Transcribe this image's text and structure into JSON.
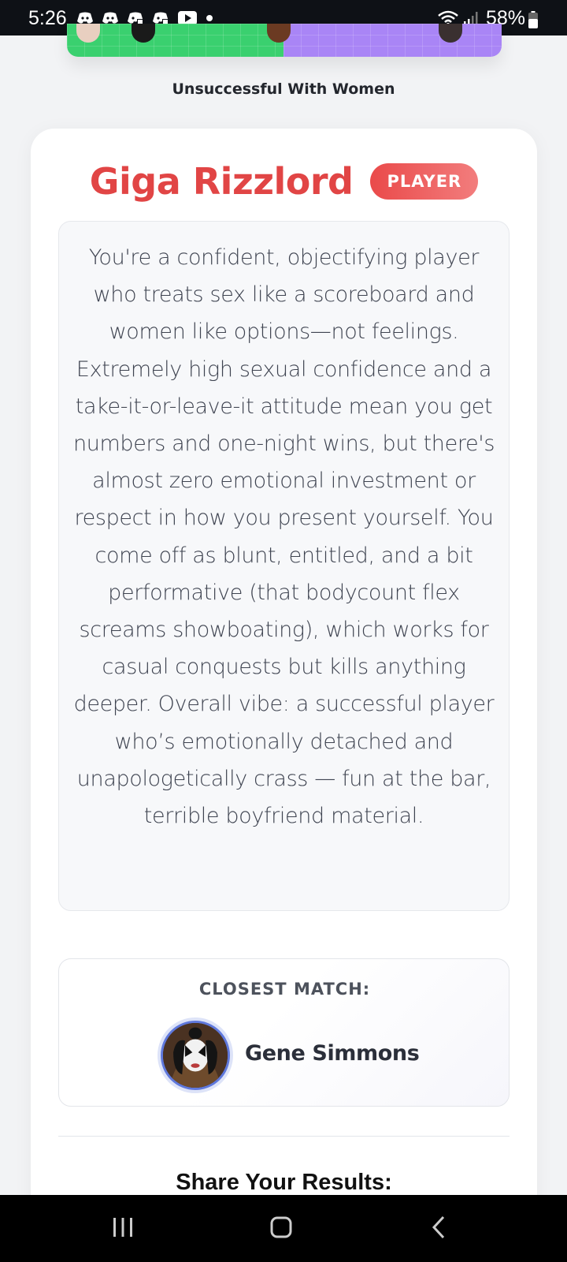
{
  "status_bar": {
    "time": "5:26",
    "battery": "58%",
    "notification_icons": [
      "discord-icon",
      "discord-icon",
      "discord-alt-icon",
      "discord-alt-icon",
      "youtube-icon"
    ]
  },
  "banner": {
    "caption": "Unsuccessful With Women"
  },
  "result": {
    "title": "Giga Rizzlord",
    "badge": "PLAYER",
    "description": "You're a confident, objectifying player who treats sex like a scoreboard and women like options—not feelings. Extremely high sexual confidence and a take-it-or-leave-it attitude mean you get numbers and one-night wins, but there's almost zero emotional investment or respect in how you present yourself. You come off as blunt, entitled, and a bit performative (that bodycount flex screams showboating), which works for casual conquests but kills anything deeper. Overall vibe: a successful player who’s emotionally detached and unapologetically crass — fun at the bar, terrible boyfriend material."
  },
  "closest_match": {
    "label": "CLOSEST MATCH:",
    "name": "Gene Simmons"
  },
  "share": {
    "title": "Share Your Results:"
  },
  "colors": {
    "accent_red": "#e14545",
    "banner_green": "#3ad06f",
    "banner_purple": "#a985f6",
    "avatar_ring": "#5f78dc"
  }
}
